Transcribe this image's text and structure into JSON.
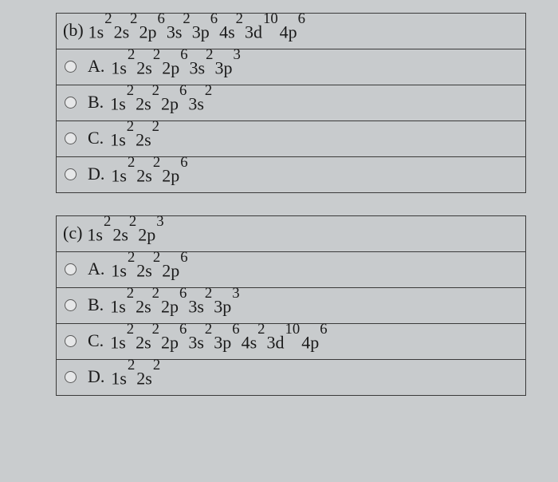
{
  "questions": [
    {
      "id": "b",
      "label": "(b)",
      "config": "1s²2s²2p⁶3s²3p⁶4s²3d¹⁰4p⁶",
      "options": [
        {
          "letter": "A.",
          "config": "1s²2s²2p⁶3s²3p³"
        },
        {
          "letter": "B.",
          "config": "1s²2s²2p⁶3s²"
        },
        {
          "letter": "C.",
          "config": "1s²2s²"
        },
        {
          "letter": "D.",
          "config": "1s²2s²2p⁶"
        }
      ]
    },
    {
      "id": "c",
      "label": "(c)",
      "config": "1s²2s²2p³",
      "options": [
        {
          "letter": "A.",
          "config": "1s²2s²2p⁶"
        },
        {
          "letter": "B.",
          "config": "1s²2s²2p⁶3s²3p³"
        },
        {
          "letter": "C.",
          "config": "1s²2s²2p⁶3s²3p⁶4s²3d¹⁰4p⁶"
        },
        {
          "letter": "D.",
          "config": "1s²2s²"
        }
      ]
    }
  ]
}
